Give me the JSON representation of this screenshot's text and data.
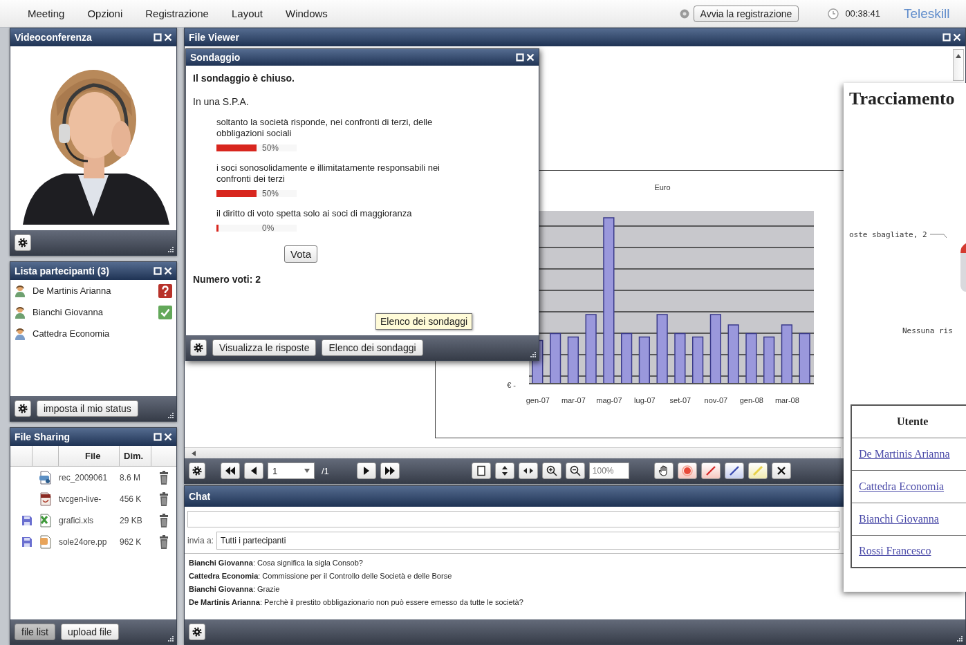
{
  "menu": {
    "items": [
      "Meeting",
      "Opzioni",
      "Registrazione",
      "Layout",
      "Windows"
    ],
    "recording": false,
    "record_button": "Avvia la registrazione",
    "timer": "00:38:41",
    "brand": "Teleskill"
  },
  "videoconference": {
    "title": "Videoconferenza"
  },
  "participants": {
    "title": "Lista partecipanti (3)",
    "items": [
      {
        "name": "De Martinis Arianna",
        "kind": "question"
      },
      {
        "name": "Bianchi Giovanna",
        "kind": "confirmed"
      },
      {
        "name": "Cattedra Economia",
        "kind": "plain"
      }
    ],
    "status_button": "imposta il mio status"
  },
  "file_sharing": {
    "title": "File Sharing",
    "columns": [
      "File",
      "Dim."
    ],
    "files": [
      {
        "name": "rec_2009061",
        "size": "8.6 M",
        "kind": "video",
        "saved": false
      },
      {
        "name": "tvcgen-live-",
        "size": "456 K",
        "kind": "pdf",
        "saved": false
      },
      {
        "name": "grafici.xls",
        "size": "29 KB",
        "kind": "sheet",
        "saved": true
      },
      {
        "name": "sole24ore.pp",
        "size": "962 K",
        "kind": "slides",
        "saved": true
      }
    ],
    "buttons": [
      {
        "label": "file list",
        "selected": true
      },
      {
        "label": "upload file",
        "selected": false
      }
    ]
  },
  "viewer": {
    "title": "File Viewer",
    "page": "1",
    "page_count": "/1",
    "zoom": "100%",
    "chart": {
      "title": "Euro",
      "y_label": "€ -",
      "x_labels": [
        "gen-07",
        "mar-07",
        "mag-07",
        "lug-07",
        "set-07",
        "nov-07",
        "gen-08",
        "mar-08"
      ]
    }
  },
  "poll": {
    "title": "Sondaggio",
    "status": "Il sondaggio è chiuso.",
    "question": "In una S.P.A.",
    "options": [
      {
        "text": "soltanto la società risponde, nei confronti di terzi, delle obbligazioni sociali",
        "level": 0.5,
        "reading": "50%"
      },
      {
        "text": "i soci sonosolidamente e illimitatamente responsabili nei confronti dei terzi",
        "level": 0.5,
        "reading": "50%"
      },
      {
        "text": "il diritto di voto spetta solo ai soci di maggioranza",
        "level": 0,
        "reading": "0%"
      }
    ],
    "vote_button": "Vota",
    "votes": "Numero voti: 2",
    "tooltip": "Elenco dei sondaggi",
    "buttons": [
      "Visualizza le risposte",
      "Elenco dei sondaggi"
    ]
  },
  "chat": {
    "title": "Chat",
    "recipient_label": "invia a:",
    "recipient": "Tutti i partecipanti",
    "messages": [
      "**Bianchi Giovanna**: Cosa significa la sigla Consob?",
      "**Cattedra Economia**: Commissione per il Controllo delle Società e delle Borse",
      "**Bianchi Giovanna**: Grazie",
      "**De Martinis Arianna**: Perchè il prestito obbligazionario non può essere emesso da tutte le società?"
    ]
  },
  "tracking": {
    "title": "Tracciamento",
    "pie_label": "oste sbagliate, 2",
    "pie_note": "Nessuna ris",
    "table": {
      "columns": [
        "Utente"
      ],
      "rows": [
        "De Martinis Arianna",
        "Cattedra Economia",
        "Bianchi Giovanna",
        "Rossi Francesco"
      ]
    }
  }
}
